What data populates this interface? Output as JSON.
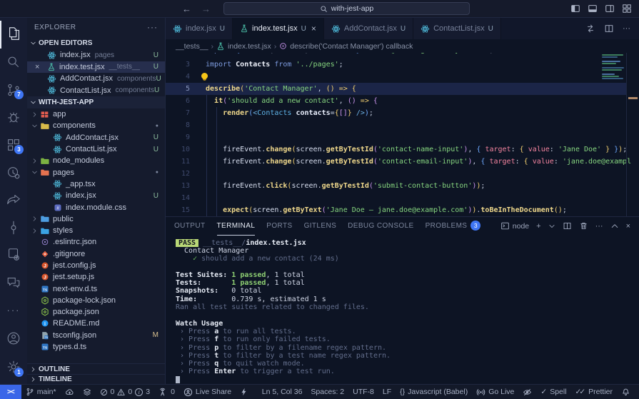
{
  "title_bar": {
    "search_value": "with-jest-app",
    "nav": {
      "back": "back-arrow",
      "forward": "forward-arrow"
    },
    "window_icons": [
      "layout-sidebar-left",
      "layout-panel",
      "layout-sidebar-right",
      "layout-customize"
    ]
  },
  "activity_bar": {
    "items": [
      {
        "id": "explorer",
        "active": true
      },
      {
        "id": "search"
      },
      {
        "id": "source-control",
        "badge": "7"
      },
      {
        "id": "run-debug"
      },
      {
        "id": "extensions",
        "badge": "3"
      },
      {
        "id": "live-share"
      },
      {
        "id": "share"
      },
      {
        "id": "commit-graph"
      },
      {
        "id": "remote-runner"
      },
      {
        "id": "comments"
      },
      {
        "id": "more"
      }
    ],
    "bottom": [
      {
        "id": "account"
      },
      {
        "id": "settings",
        "badge": "1"
      }
    ]
  },
  "sidebar": {
    "title": "EXPLORER",
    "open_editors_label": "OPEN EDITORS",
    "workspace_label": "WITH-JEST-APP",
    "outline_label": "OUTLINE",
    "timeline_label": "TIMELINE",
    "open_editors": [
      {
        "icon": "react",
        "name": "index.jsx",
        "detail": "pages",
        "badge": "U"
      },
      {
        "icon": "flask",
        "name": "index.test.jsx",
        "detail": "__tests__",
        "badge": "U",
        "active": true
      },
      {
        "icon": "react",
        "name": "AddContact.jsx",
        "detail": "components",
        "badge": "U"
      },
      {
        "icon": "react",
        "name": "ContactList.jsx",
        "detail": "components",
        "badge": "U"
      }
    ],
    "tree": [
      {
        "chev": "r",
        "icon": "folder-app",
        "label": "app"
      },
      {
        "chev": "d",
        "icon": "folder-components",
        "label": "components",
        "dot": true
      },
      {
        "child": true,
        "icon": "react",
        "label": "AddContact.jsx",
        "badge": "U"
      },
      {
        "child": true,
        "icon": "react",
        "label": "ContactList.jsx",
        "badge": "U"
      },
      {
        "chev": "r",
        "icon": "folder-node",
        "label": "node_modules"
      },
      {
        "chev": "d",
        "icon": "folder-pages",
        "label": "pages",
        "dot": true
      },
      {
        "child": true,
        "icon": "react",
        "label": "_app.tsx"
      },
      {
        "child": true,
        "icon": "react",
        "label": "index.jsx",
        "badge": "U"
      },
      {
        "child": true,
        "icon": "css",
        "label": "index.module.css"
      },
      {
        "chev": "r",
        "icon": "folder-public",
        "label": "public"
      },
      {
        "chev": "r",
        "icon": "folder-styles",
        "label": "styles"
      },
      {
        "icon": "eslint",
        "label": ".eslintrc.json"
      },
      {
        "icon": "git",
        "label": ".gitignore"
      },
      {
        "icon": "jest",
        "label": "jest.config.js"
      },
      {
        "icon": "jest",
        "label": "jest.setup.js"
      },
      {
        "icon": "ts",
        "label": "next-env.d.ts"
      },
      {
        "icon": "npm",
        "label": "package-lock.json"
      },
      {
        "icon": "npm",
        "label": "package.json"
      },
      {
        "icon": "readme",
        "label": "README.md"
      },
      {
        "icon": "tsconfig",
        "label": "tsconfig.json",
        "badge": "M"
      },
      {
        "icon": "ts",
        "label": "types.d.ts"
      }
    ]
  },
  "tabs": [
    {
      "icon": "react",
      "label": "index.jsx",
      "badge": "U"
    },
    {
      "icon": "flask",
      "label": "index.test.jsx",
      "badge": "U",
      "active": true,
      "close": true
    },
    {
      "icon": "react",
      "label": "AddContact.jsx",
      "badge": "U"
    },
    {
      "icon": "react",
      "label": "ContactList.jsx",
      "badge": "U"
    }
  ],
  "tab_actions": [
    "compare",
    "split-editor",
    "more"
  ],
  "breadcrumb": [
    {
      "label": "__tests__"
    },
    {
      "icon": "flask",
      "label": "index.test.jsx"
    },
    {
      "icon": "symbol",
      "label": "describe('Contact Manager') callback"
    }
  ],
  "code": {
    "lines": [
      {
        "num": 2,
        "clip": true,
        "seg": [
          [
            "kw",
            "import "
          ],
          [
            "pb",
            "{"
          ],
          [
            "plain",
            " render, screen, fireEvent "
          ],
          [
            "pb",
            "}"
          ],
          [
            "kw",
            " from "
          ],
          [
            "str",
            "'@testing-library/react'"
          ],
          [
            "plain",
            ";"
          ]
        ]
      },
      {
        "num": 3,
        "seg": [
          [
            "kw",
            "import "
          ],
          [
            "idb",
            "Contacts"
          ],
          [
            "kw",
            " from "
          ],
          [
            "str",
            "'../pages'"
          ],
          [
            "plain",
            ";"
          ]
        ]
      },
      {
        "num": 4,
        "bulb": true,
        "seg": []
      },
      {
        "num": 5,
        "current": true,
        "seg": [
          [
            "fn",
            "describe"
          ],
          [
            "py",
            "("
          ],
          [
            "str",
            "'Contact Manager'"
          ],
          [
            "plain",
            ", "
          ],
          [
            "py",
            "()"
          ],
          [
            "plain",
            " "
          ],
          [
            "py",
            "=>"
          ],
          [
            "plain",
            " "
          ],
          [
            "py",
            "{"
          ]
        ]
      },
      {
        "num": 6,
        "seg": [
          [
            "plain",
            "  "
          ],
          [
            "fn",
            "it"
          ],
          [
            "pp",
            "("
          ],
          [
            "str",
            "'should add a new contact'"
          ],
          [
            "plain",
            ", "
          ],
          [
            "pp",
            "()"
          ],
          [
            "plain",
            " "
          ],
          [
            "py",
            "=>"
          ],
          [
            "plain",
            " "
          ],
          [
            "pp",
            "{"
          ]
        ]
      },
      {
        "num": 7,
        "seg": [
          [
            "plain",
            "    "
          ],
          [
            "fn",
            "render"
          ],
          [
            "pb",
            "("
          ],
          [
            "tag",
            "<"
          ],
          [
            "cmp",
            "Contacts"
          ],
          [
            "plain",
            " "
          ],
          [
            "attr",
            "contacts"
          ],
          [
            "plain",
            "="
          ],
          [
            "py",
            "{"
          ],
          [
            "pp",
            "[]"
          ],
          [
            "py",
            "}"
          ],
          [
            "tag",
            " />"
          ],
          [
            "pb",
            ")"
          ],
          [
            "plain",
            ";"
          ]
        ]
      },
      {
        "num": 8,
        "seg": []
      },
      {
        "num": 9,
        "seg": []
      },
      {
        "num": 10,
        "seg": [
          [
            "plain",
            "    "
          ],
          [
            "id",
            "fireEvent"
          ],
          [
            "plain",
            "."
          ],
          [
            "fn",
            "change"
          ],
          [
            "py",
            "("
          ],
          [
            "id",
            "screen"
          ],
          [
            "plain",
            "."
          ],
          [
            "fn",
            "getByTestId"
          ],
          [
            "pp",
            "("
          ],
          [
            "str",
            "'contact-name-input'"
          ],
          [
            "pp",
            ")"
          ],
          [
            "plain",
            ", "
          ],
          [
            "pb",
            "{"
          ],
          [
            "plain",
            " "
          ],
          [
            "prop",
            "target"
          ],
          [
            "plain",
            ": "
          ],
          [
            "py",
            "{"
          ],
          [
            "plain",
            " "
          ],
          [
            "prop",
            "value"
          ],
          [
            "plain",
            ": "
          ],
          [
            "str",
            "'Jane Doe'"
          ],
          [
            "py",
            " }"
          ],
          [
            "pb",
            " }"
          ],
          [
            "py",
            ")"
          ],
          [
            "plain",
            ";"
          ]
        ]
      },
      {
        "num": 11,
        "seg": [
          [
            "plain",
            "    "
          ],
          [
            "id",
            "fireEvent"
          ],
          [
            "plain",
            "."
          ],
          [
            "fn",
            "change"
          ],
          [
            "py",
            "("
          ],
          [
            "id",
            "screen"
          ],
          [
            "plain",
            "."
          ],
          [
            "fn",
            "getByTestId"
          ],
          [
            "pp",
            "("
          ],
          [
            "str",
            "'contact-email-input'"
          ],
          [
            "pp",
            ")"
          ],
          [
            "plain",
            ", "
          ],
          [
            "pb",
            "{"
          ],
          [
            "plain",
            " "
          ],
          [
            "prop",
            "target"
          ],
          [
            "plain",
            ": "
          ],
          [
            "py",
            "{"
          ],
          [
            "plain",
            " "
          ],
          [
            "prop",
            "value"
          ],
          [
            "plain",
            ": "
          ],
          [
            "str",
            "'jane.doe@exampl"
          ]
        ]
      },
      {
        "num": 12,
        "seg": []
      },
      {
        "num": 13,
        "seg": [
          [
            "plain",
            "    "
          ],
          [
            "id",
            "fireEvent"
          ],
          [
            "plain",
            "."
          ],
          [
            "fn",
            "click"
          ],
          [
            "py",
            "("
          ],
          [
            "id",
            "screen"
          ],
          [
            "plain",
            "."
          ],
          [
            "fn",
            "getByTestId"
          ],
          [
            "pp",
            "("
          ],
          [
            "str",
            "'submit-contact-button'"
          ],
          [
            "pp",
            ")"
          ],
          [
            "py",
            ")"
          ],
          [
            "plain",
            ";"
          ]
        ]
      },
      {
        "num": 14,
        "seg": []
      },
      {
        "num": 15,
        "seg": [
          [
            "plain",
            "    "
          ],
          [
            "fn",
            "expect"
          ],
          [
            "py",
            "("
          ],
          [
            "id",
            "screen"
          ],
          [
            "plain",
            "."
          ],
          [
            "fn",
            "getByText"
          ],
          [
            "pp",
            "("
          ],
          [
            "str",
            "'Jane Doe — jane.doe@example.com'"
          ],
          [
            "pp",
            ")"
          ],
          [
            "py",
            ")"
          ],
          [
            "plain",
            "."
          ],
          [
            "fn",
            "toBeInTheDocument"
          ],
          [
            "py",
            "()"
          ],
          [
            "plain",
            ";"
          ]
        ]
      }
    ]
  },
  "panel": {
    "tabs": [
      {
        "label": "OUTPUT"
      },
      {
        "label": "TERMINAL",
        "active": true
      },
      {
        "label": "PORTS"
      },
      {
        "label": "GITLENS"
      },
      {
        "label": "DEBUG CONSOLE"
      },
      {
        "label": "PROBLEMS",
        "badge": "3"
      }
    ],
    "shell_label": "node",
    "actions": [
      "new-terminal",
      "shell-picker",
      "split-terminal",
      "kill-terminal",
      "more",
      "maximize-panel",
      "close-panel"
    ]
  },
  "terminal": {
    "lines": [
      [
        [
          "badge",
          "PASS"
        ],
        [
          "w",
          " "
        ],
        [
          "dim",
          "__tests__/"
        ],
        [
          "b",
          "index.test.jsx"
        ]
      ],
      [
        [
          "w",
          "  Contact Manager"
        ]
      ],
      [
        [
          "chk",
          "    ✓"
        ],
        [
          "dim",
          " should add a new contact (24 ms)"
        ]
      ],
      [],
      [
        [
          "b",
          "Test Suites: "
        ],
        [
          "g",
          "1 passed"
        ],
        [
          "w",
          ", 1 total"
        ]
      ],
      [
        [
          "b",
          "Tests:       "
        ],
        [
          "g",
          "1 passed"
        ],
        [
          "w",
          ", 1 total"
        ]
      ],
      [
        [
          "b",
          "Snapshots:   "
        ],
        [
          "w",
          "0 total"
        ]
      ],
      [
        [
          "b",
          "Time:        "
        ],
        [
          "w",
          "0.739 s, estimated 1 s"
        ]
      ],
      [
        [
          "dim",
          "Ran all test suites related to changed files."
        ]
      ],
      [],
      [
        [
          "b",
          "Watch Usage"
        ]
      ],
      [
        [
          "dim",
          " › Press "
        ],
        [
          "b",
          "a"
        ],
        [
          "dim",
          " to run all tests."
        ]
      ],
      [
        [
          "dim",
          " › Press "
        ],
        [
          "b",
          "f"
        ],
        [
          "dim",
          " to run only failed tests."
        ]
      ],
      [
        [
          "dim",
          " › Press "
        ],
        [
          "b",
          "p"
        ],
        [
          "dim",
          " to filter by a filename regex pattern."
        ]
      ],
      [
        [
          "dim",
          " › Press "
        ],
        [
          "b",
          "t"
        ],
        [
          "dim",
          " to filter by a test name regex pattern."
        ]
      ],
      [
        [
          "dim",
          " › Press "
        ],
        [
          "b",
          "q"
        ],
        [
          "dim",
          " to quit watch mode."
        ]
      ],
      [
        [
          "dim",
          " › Press "
        ],
        [
          "b",
          "Enter"
        ],
        [
          "dim",
          " to trigger a test run."
        ]
      ],
      [
        [
          "cursor",
          ""
        ]
      ]
    ]
  },
  "status_bar": {
    "remote": "><",
    "left": [
      {
        "id": "branch",
        "icon": "branch",
        "text": "main*"
      },
      {
        "id": "publish",
        "icon": "cloud"
      },
      {
        "id": "gitlens",
        "icon": "layers"
      },
      {
        "id": "problems",
        "stats": [
          {
            "icon": "error",
            "n": "0"
          },
          {
            "icon": "warning",
            "n": "0"
          },
          {
            "icon": "info",
            "n": "3"
          }
        ]
      },
      {
        "id": "ports",
        "icon": "tower",
        "text": "0"
      },
      {
        "id": "live-share",
        "icon": "liveshare",
        "text": "Live Share"
      },
      {
        "id": "bolt",
        "icon": "bolt"
      }
    ],
    "right": [
      {
        "id": "cursor-position",
        "text": "Ln 5, Col 36"
      },
      {
        "id": "indentation",
        "text": "Spaces: 2"
      },
      {
        "id": "encoding",
        "text": "UTF-8"
      },
      {
        "id": "eol",
        "text": "LF"
      },
      {
        "id": "language",
        "icon": "braces",
        "text": "Javascript (Babel)"
      },
      {
        "id": "go-live",
        "icon": "broadcast",
        "text": "Go Live"
      },
      {
        "id": "exclude",
        "icon": "eyeslash"
      },
      {
        "id": "spell",
        "icon": "check",
        "text": "Spell"
      },
      {
        "id": "prettier",
        "icon": "doublecheck",
        "text": "Prettier"
      },
      {
        "id": "notifications",
        "icon": "bell"
      }
    ]
  }
}
